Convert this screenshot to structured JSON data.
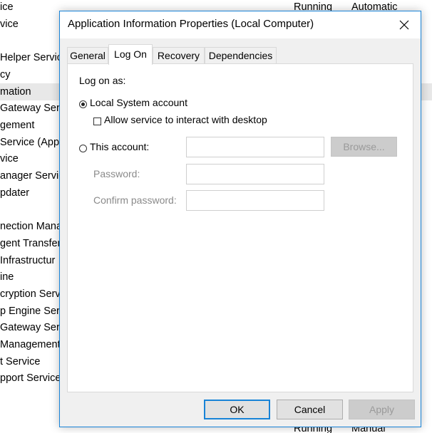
{
  "background": {
    "rows": [
      {
        "text": "ice",
        "status": "Running",
        "startup": "Automatic"
      },
      {
        "text": "vice"
      },
      {
        "text": ""
      },
      {
        "text": "Helper Service"
      },
      {
        "text": "cy"
      },
      {
        "text": "mation"
      },
      {
        "text": "Gateway Serv"
      },
      {
        "text": "gement"
      },
      {
        "text": " Service (App"
      },
      {
        "text": "vice"
      },
      {
        "text": "anager Servic"
      },
      {
        "text": "pdater"
      },
      {
        "text": ""
      },
      {
        "text": "nection Mana"
      },
      {
        "text": "gent Transfer"
      },
      {
        "text": " Infrastructur"
      },
      {
        "text": "ine"
      },
      {
        "text": "cryption Serv"
      },
      {
        "text": "p Engine Serv"
      },
      {
        "text": "Gateway Servi"
      },
      {
        "text": "Management"
      },
      {
        "text": "t Service"
      },
      {
        "text": "pport Service"
      }
    ],
    "bottom_row": {
      "status": "Running",
      "startup": "Manual"
    }
  },
  "dialog": {
    "title": "Application Information Properties (Local Computer)",
    "tabs": [
      {
        "label": "General",
        "active": false
      },
      {
        "label": "Log On",
        "active": true
      },
      {
        "label": "Recovery",
        "active": false
      },
      {
        "label": "Dependencies",
        "active": false
      }
    ],
    "logon": {
      "heading": "Log on as:",
      "local_system_label": "Local System account",
      "local_system_checked": true,
      "interact_desktop_label": "Allow service to interact with desktop",
      "interact_desktop_checked": false,
      "this_account_label": "This account:",
      "this_account_checked": false,
      "this_account_value": "",
      "browse_label": "Browse...",
      "password_label": "Password:",
      "password_value": "",
      "confirm_password_label": "Confirm password:",
      "confirm_password_value": ""
    },
    "buttons": {
      "ok": "OK",
      "cancel": "Cancel",
      "apply": "Apply"
    },
    "accent_color": "#1883d7"
  }
}
